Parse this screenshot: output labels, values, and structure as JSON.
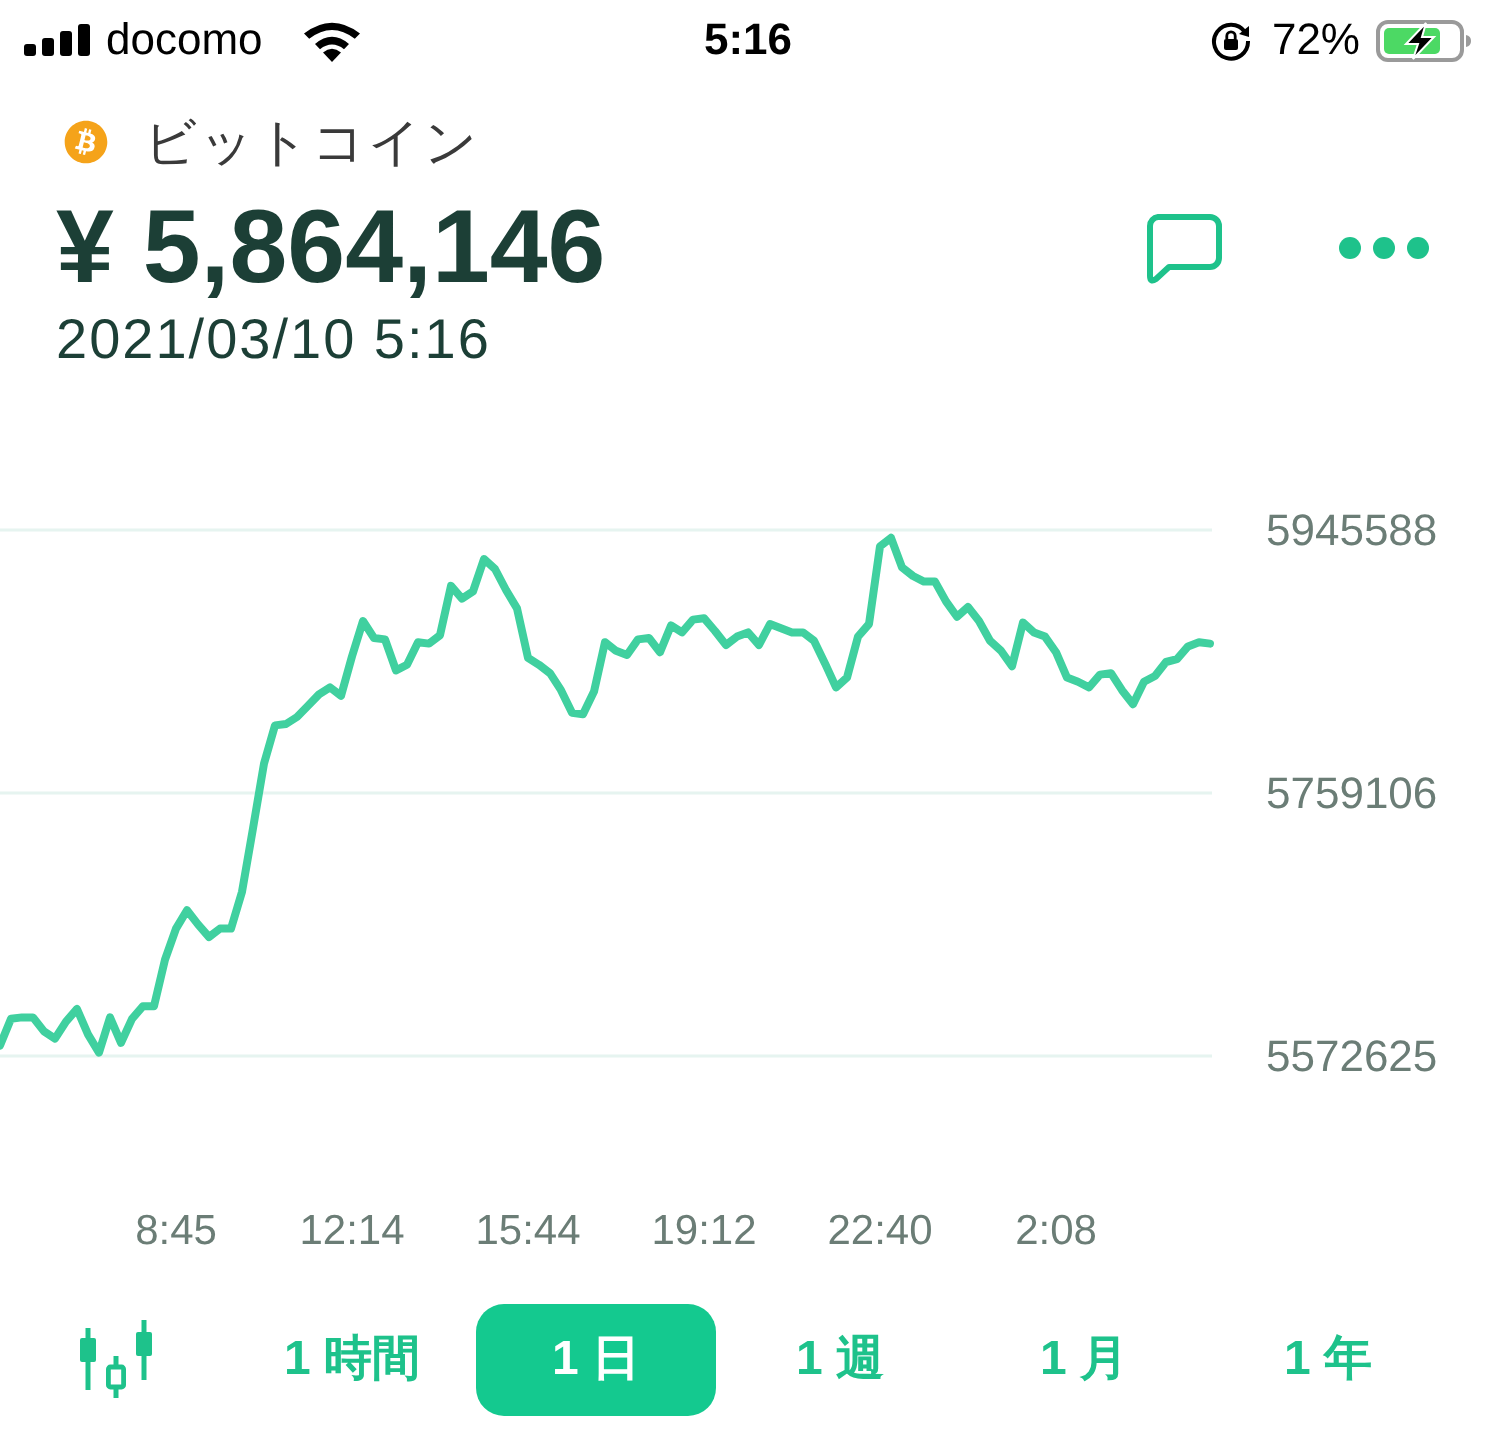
{
  "status_bar": {
    "carrier": "docomo",
    "time": "5:16",
    "battery": "72%"
  },
  "header": {
    "coin_name": "ビットコイン",
    "price": "¥ 5,864,146",
    "timestamp": "2021/03/10 5:16"
  },
  "chart": {
    "chart_data": {
      "type": "line",
      "grid": true,
      "ylim": [
        5572625,
        5945588
      ],
      "yticks": [
        5945588,
        5759106,
        5572625
      ],
      "categories": [
        null,
        null,
        null,
        null,
        null,
        null,
        null,
        null,
        null,
        null,
        null,
        null,
        null,
        null,
        null,
        null,
        "8:45",
        null,
        null,
        null,
        null,
        null,
        null,
        null,
        null,
        null,
        null,
        null,
        null,
        null,
        null,
        null,
        "12:14",
        null,
        null,
        null,
        null,
        null,
        null,
        null,
        null,
        null,
        null,
        null,
        null,
        null,
        null,
        null,
        "15:44",
        null,
        null,
        null,
        null,
        null,
        null,
        null,
        null,
        null,
        null,
        null,
        null,
        null,
        null,
        null,
        "19:12",
        null,
        null,
        null,
        null,
        null,
        null,
        null,
        null,
        null,
        null,
        null,
        null,
        null,
        null,
        null,
        "22:40",
        null,
        null,
        null,
        null,
        null,
        null,
        null,
        null,
        null,
        null,
        null,
        null,
        null,
        null,
        null,
        "2:08",
        null,
        null,
        null,
        null,
        null,
        null,
        null,
        null,
        null,
        null,
        null,
        null,
        null,
        null
      ],
      "series": [
        {
          "color": "#40d09f",
          "values": [
            5580000,
            5599000,
            5600000,
            5600000,
            5590000,
            5585000,
            5597000,
            5606000,
            5588000,
            5575000,
            5600000,
            5582000,
            5599000,
            5608000,
            5608000,
            5641000,
            5663000,
            5676000,
            5666000,
            5657000,
            5663000,
            5663000,
            5689000,
            5734000,
            5780000,
            5807000,
            5808000,
            5813000,
            5821000,
            5829000,
            5834000,
            5828000,
            5856000,
            5881000,
            5869000,
            5868000,
            5846000,
            5850000,
            5866000,
            5865000,
            5871000,
            5906000,
            5897000,
            5902000,
            5925000,
            5918000,
            5903000,
            5890000,
            5855000,
            5850000,
            5844000,
            5832000,
            5816000,
            5815000,
            5831000,
            5866000,
            5860000,
            5857000,
            5868000,
            5869000,
            5859000,
            5878000,
            5873000,
            5882000,
            5883000,
            5874000,
            5864000,
            5870000,
            5873000,
            5864000,
            5879000,
            5876000,
            5873000,
            5873000,
            5867000,
            5851000,
            5834000,
            5841000,
            5870000,
            5879000,
            5934000,
            5940000,
            5919000,
            5913000,
            5909000,
            5909000,
            5895000,
            5884000,
            5891000,
            5881000,
            5867000,
            5860000,
            5849000,
            5880000,
            5873000,
            5870000,
            5859000,
            5841000,
            5838000,
            5834000,
            5843000,
            5844000,
            5832000,
            5822000,
            5838000,
            5842000,
            5852000,
            5854000,
            5863000,
            5866000,
            5865000
          ]
        }
      ]
    }
  },
  "range_tabs": [
    {
      "label": "1 時間",
      "selected": false
    },
    {
      "label": "1 日",
      "selected": true
    },
    {
      "label": "1 週",
      "selected": false
    },
    {
      "label": "1 月",
      "selected": false
    },
    {
      "label": "1 年",
      "selected": false
    }
  ]
}
